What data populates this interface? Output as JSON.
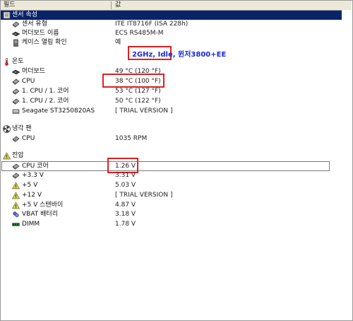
{
  "header": {
    "field": "필드",
    "value": "값"
  },
  "sensor_props": {
    "title": "센서 속성",
    "items": [
      {
        "label": "센서 유형",
        "value": "ITE IT8716F  (ISA 228h)",
        "icon": "sensor-chip-icon"
      },
      {
        "label": "머더보드 이름",
        "value": "ECS RS485M-M",
        "icon": "motherboard-icon"
      },
      {
        "label": "케이스 열림 확인",
        "value": "예",
        "icon": "case-icon"
      }
    ]
  },
  "annotation": "2GHz, Idle, 윈저3800+EE",
  "temperature": {
    "title": "온도",
    "items": [
      {
        "label": "머더보드",
        "value": "49 °C  (120 °F)",
        "icon": "motherboard-icon"
      },
      {
        "label": "CPU",
        "value": "38 °C  (100 °F)",
        "icon": "cpu-icon"
      },
      {
        "label": "1. CPU / 1. 코어",
        "value": "53 °C  (127 °F)",
        "icon": "cpu-core-icon"
      },
      {
        "label": "1. CPU / 2. 코어",
        "value": "50 °C  (122 °F)",
        "icon": "cpu-core-icon"
      },
      {
        "label": "Seagate ST3250820AS",
        "value": "[ TRIAL VERSION ]",
        "icon": "hdd-icon"
      }
    ]
  },
  "cooling": {
    "title": "냉각 팬",
    "items": [
      {
        "label": "CPU",
        "value": "1035 RPM",
        "icon": "cpu-icon"
      }
    ]
  },
  "voltage": {
    "title": "전압",
    "items": [
      {
        "label": "CPU 코어",
        "value": "1.26 V",
        "icon": "cpu-icon"
      },
      {
        "label": "+3.3 V",
        "value": "3.31 V",
        "icon": "cpu-icon"
      },
      {
        "label": "+5 V",
        "value": "5.03 V",
        "icon": "voltage-warning-icon"
      },
      {
        "label": "+12 V",
        "value": "[ TRIAL VERSION ]",
        "icon": "voltage-warning-icon"
      },
      {
        "label": "+5 V 스탠바이",
        "value": "4.87 V",
        "icon": "voltage-warning-icon"
      },
      {
        "label": "VBAT 배터리",
        "value": "3.18 V",
        "icon": "battery-icon"
      },
      {
        "label": "DIMM",
        "value": "1.78 V",
        "icon": "dimm-icon"
      }
    ]
  }
}
